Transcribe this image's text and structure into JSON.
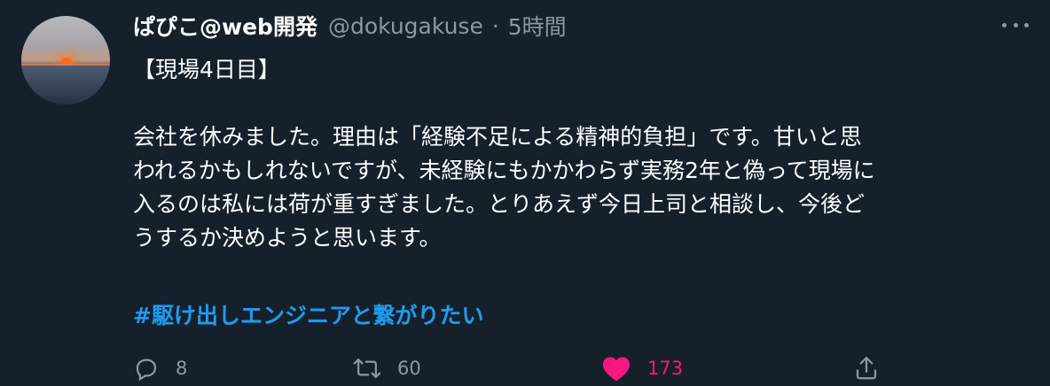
{
  "user": {
    "display_name": "ぱぴこ@web開発",
    "handle": "@dokugakuse",
    "separator": "·",
    "time": "5時間"
  },
  "tweet": {
    "lines": [
      "【現場4日目】",
      "",
      "会社を休みました。理由は「経験不足による精神的負担」です。甘いと思",
      "われるかもしれないですが、未経験にもかかわらず実務2年と偽って現場に",
      "入るのは私には荷が重すぎました。とりあえず今日上司と相談し、今後ど",
      "うするか決めようと思います。"
    ],
    "hashtag": "#駆け出しエンジニアと繋がりたい"
  },
  "actions": {
    "reply_count": "8",
    "retweet_count": "60",
    "like_count": "173"
  },
  "colors": {
    "background": "#15202b",
    "secondary_text": "#8b98a5",
    "link": "#1d9bf0",
    "like": "#f91880"
  },
  "icons": {
    "more": "more-horizontal-icon",
    "reply": "reply-icon",
    "retweet": "retweet-icon",
    "like": "heart-icon",
    "share": "share-icon"
  }
}
